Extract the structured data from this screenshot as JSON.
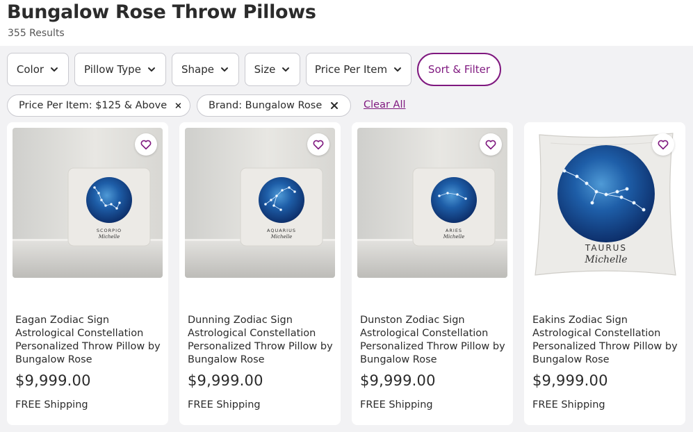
{
  "header": {
    "title": "Bungalow Rose Throw Pillows",
    "result_count": "355 Results"
  },
  "filters": [
    {
      "label": "Color"
    },
    {
      "label": "Pillow Type"
    },
    {
      "label": "Shape"
    },
    {
      "label": "Size"
    },
    {
      "label": "Price Per Item"
    }
  ],
  "sort_filter_label": "Sort & Filter",
  "applied_filters": [
    {
      "label": "Price Per Item: $125 & Above"
    },
    {
      "label": "Brand: Bungalow Rose"
    }
  ],
  "clear_all_label": "Clear All",
  "products": [
    {
      "name": "Eagan Zodiac Sign Astrological Constellation Personalized Throw Pillow by Bungalow Rose",
      "price": "$9,999.00",
      "shipping": "FREE Shipping",
      "sign": "SCORPIO",
      "pillow_name": "Michelle"
    },
    {
      "name": "Dunning Zodiac Sign Astrological Constellation Personalized Throw Pillow by Bungalow Rose",
      "price": "$9,999.00",
      "shipping": "FREE Shipping",
      "sign": "AQUARIUS",
      "pillow_name": "Michelle"
    },
    {
      "name": "Dunston Zodiac Sign Astrological Constellation Personalized Throw Pillow by Bungalow Rose",
      "price": "$9,999.00",
      "shipping": "FREE Shipping",
      "sign": "ARIES",
      "pillow_name": "Michelle"
    },
    {
      "name": "Eakins Zodiac Sign Astrological Constellation Personalized Throw Pillow by Bungalow Rose",
      "price": "$9,999.00",
      "shipping": "FREE Shipping",
      "sign": "TAURUS",
      "pillow_name": "Michelle"
    }
  ],
  "colors": {
    "accent": "#7f187f",
    "background": "#f2f2f4",
    "text": "#2b2b2b"
  },
  "icons": {
    "dropdown": "chevron-down-icon",
    "remove_filter": "close-icon",
    "favorite": "heart-icon"
  }
}
